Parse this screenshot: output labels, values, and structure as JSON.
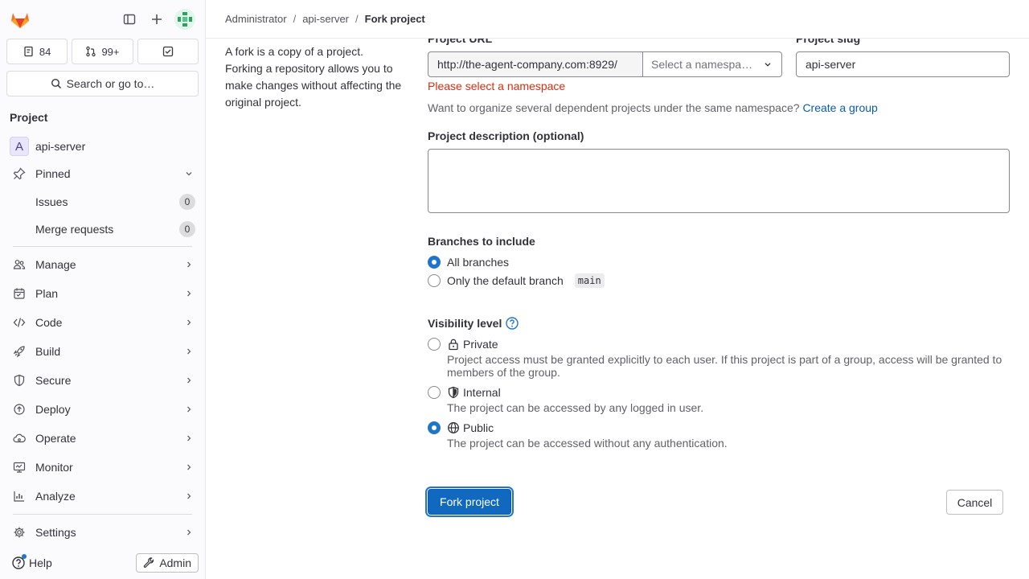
{
  "header": {
    "breadcrumbs": [
      "Administrator",
      "api-server",
      "Fork project"
    ]
  },
  "sidebar": {
    "counts": {
      "issues": "84",
      "merge_requests": "99+"
    },
    "search_label": "Search or go to…",
    "section_title": "Project",
    "project": {
      "initial": "A",
      "name": "api-server"
    },
    "pinned_label": "Pinned",
    "pinned_items": [
      {
        "label": "Issues",
        "count": "0"
      },
      {
        "label": "Merge requests",
        "count": "0"
      }
    ],
    "nav_items": [
      {
        "label": "Manage",
        "icon": "users-icon"
      },
      {
        "label": "Plan",
        "icon": "calendar-icon"
      },
      {
        "label": "Code",
        "icon": "code-icon"
      },
      {
        "label": "Build",
        "icon": "rocket-icon"
      },
      {
        "label": "Secure",
        "icon": "shield-icon"
      },
      {
        "label": "Deploy",
        "icon": "deploy-icon"
      },
      {
        "label": "Operate",
        "icon": "cloud-gear-icon"
      },
      {
        "label": "Monitor",
        "icon": "monitor-icon"
      },
      {
        "label": "Analyze",
        "icon": "chart-icon"
      }
    ],
    "settings_label": "Settings",
    "help_label": "Help",
    "admin_label": "Admin"
  },
  "main": {
    "intro": "A fork is a copy of a project. Forking a repository allows you to make changes without affecting the original project.",
    "project_url_label": "Project URL",
    "url_prefix": "http://the-agent-company.com:8929/",
    "namespace_placeholder": "Select a namespa…",
    "project_slug_label": "Project slug",
    "project_slug_value": "api-server",
    "error": "Please select a namespace",
    "hint": "Want to organize several dependent projects under the same namespace?",
    "hint_link": "Create a group",
    "description_label": "Project description (optional)",
    "branches_label": "Branches to include",
    "branch_all": "All branches",
    "branch_default": "Only the default branch",
    "branch_default_name": "main",
    "visibility_label": "Visibility level",
    "visibility": [
      {
        "title": "Private",
        "desc": "Project access must be granted explicitly to each user. If this project is part of a group, access will be granted to members of the group."
      },
      {
        "title": "Internal",
        "desc": "The project can be accessed by any logged in user."
      },
      {
        "title": "Public",
        "desc": "The project can be accessed without any authentication."
      }
    ],
    "fork_button": "Fork project",
    "cancel_button": "Cancel"
  },
  "colors": {
    "primary": "#1068bf",
    "error": "#dd2b0e",
    "link": "#0b5cad",
    "brand": "#e24329"
  }
}
